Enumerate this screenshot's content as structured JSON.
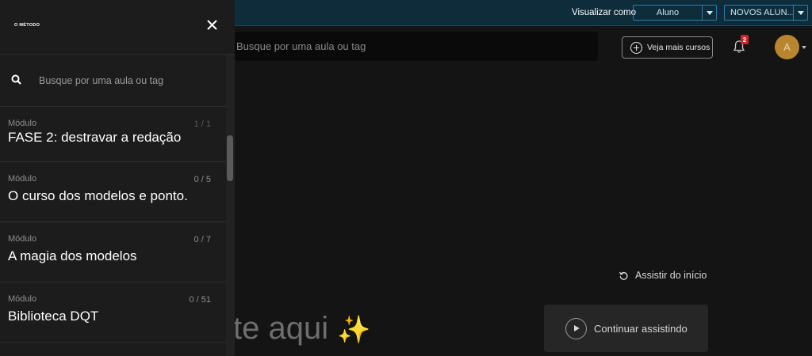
{
  "topbar": {
    "view_as_label": "Visualizar como",
    "role_select": "Aluno",
    "group_select": "NOVOS ALUN..."
  },
  "header": {
    "search_placeholder": "Busque por uma aula ou tag",
    "more_courses_label": "Veja mais cursos",
    "notifications_count": "2",
    "avatar_initial": "A"
  },
  "player": {
    "restart_label": "Assistir do início",
    "continue_label": "Continuar assistindo",
    "hero_text_partial": "te aqui",
    "hero_emoji": "✨"
  },
  "sidebar": {
    "logo_text": "O MÉTODO",
    "search_placeholder": "Busque por uma aula ou tag",
    "modules": [
      {
        "kind": "Módulo",
        "title": "FASE 2: destravar a redação",
        "count": "1 / 1"
      },
      {
        "kind": "Módulo",
        "title": "O curso dos modelos e ponto.",
        "count": "0 / 5"
      },
      {
        "kind": "Módulo",
        "title": "A magia dos modelos",
        "count": "0 / 7"
      },
      {
        "kind": "Módulo",
        "title": "Biblioteca DQT",
        "count": "0 / 51"
      }
    ]
  },
  "colors": {
    "topbar_bg": "#0e2c3a",
    "accent_select": "#2d7fa8",
    "avatar_bg": "#b8862f",
    "badge_red": "#c62828"
  }
}
